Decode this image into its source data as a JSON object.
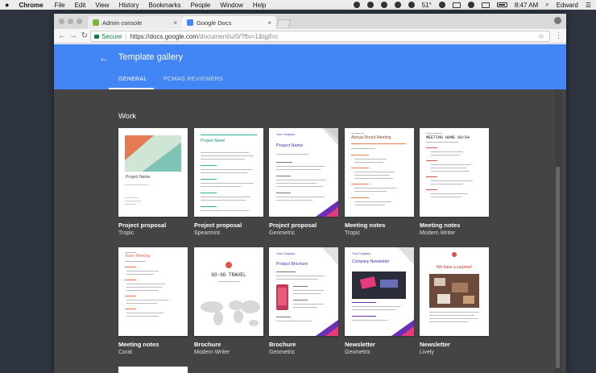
{
  "menubar": {
    "apple": "",
    "app": "Chrome",
    "items": [
      "File",
      "Edit",
      "View",
      "History",
      "Bookmarks",
      "People",
      "Window",
      "Help"
    ],
    "temperature": "51°",
    "clock": "8:47 AM",
    "user": "Edward"
  },
  "browser": {
    "tabs": [
      {
        "label": "Admin console",
        "favicon_color": "#7cb342",
        "active": false
      },
      {
        "label": "Google Docs",
        "favicon_color": "#4285f4",
        "active": true
      }
    ],
    "close_glyph": "×",
    "back_glyph": "←",
    "forward_glyph": "→",
    "reload_glyph": "↻",
    "secure_label": "Secure",
    "url_host": "https://docs.google.com",
    "url_path": "/document/u/0/?ftv=1&tgif=c",
    "star_glyph": "☆",
    "menu_glyph": "⋮"
  },
  "header": {
    "back_glyph": "←",
    "title": "Template gallery",
    "tabs": [
      {
        "label": "GENERAL",
        "active": true
      },
      {
        "label": "PCMAG REVIEWERS",
        "active": false
      }
    ],
    "accent": "#4285f4"
  },
  "section": {
    "title": "Work"
  },
  "templates": [
    {
      "name": "Project proposal",
      "style": "Tropic"
    },
    {
      "name": "Project proposal",
      "style": "Spearmint"
    },
    {
      "name": "Project proposal",
      "style": "Geometric"
    },
    {
      "name": "Meeting notes",
      "style": "Tropic"
    },
    {
      "name": "Meeting notes",
      "style": "Modern Writer"
    },
    {
      "name": "Meeting notes",
      "style": "Coral"
    },
    {
      "name": "Brochure",
      "style": "Modern Writer"
    },
    {
      "name": "Brochure",
      "style": "Geometric"
    },
    {
      "name": "Newsletter",
      "style": "Geometric"
    },
    {
      "name": "Newsletter",
      "style": "Lively"
    }
  ],
  "thumbs": {
    "t1_title": "Project Name",
    "t2_title": "Project Name",
    "t3_company": "Your Company",
    "t3_title": "Project Name",
    "t4_title": "Annual Board Meeting",
    "t5_title": "MEETING NAME 09/04",
    "t6_title": "Team Meeting",
    "t7_brand": "GO·GO TRAVEL",
    "t8_company": "Your Company",
    "t8_title": "Product Brochure",
    "t9_company": "Your Company",
    "t9_title": "Company Newsletter",
    "t10_title": "We have a surprise!"
  }
}
